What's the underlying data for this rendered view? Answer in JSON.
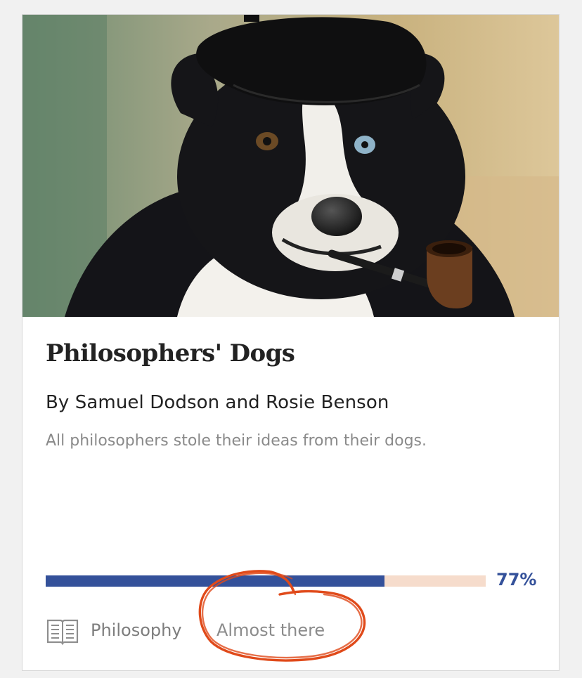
{
  "card": {
    "image_alt": "Border collie wearing a black beret with a pipe in its mouth",
    "title": "Philosophers' Dogs",
    "authors": "By Samuel Dodson and Rosie Benson",
    "description": "All philosophers stole their ideas from their dogs.",
    "progress": {
      "percent": 77,
      "label": "77%",
      "fill_color": "#34519a",
      "track_color": "#f6dccc"
    },
    "footer": {
      "icon": "open-book-icon",
      "category": "Philosophy",
      "status": "Almost there"
    }
  },
  "annotation": {
    "shape": "hand-drawn circle",
    "color": "#e04a1a"
  }
}
